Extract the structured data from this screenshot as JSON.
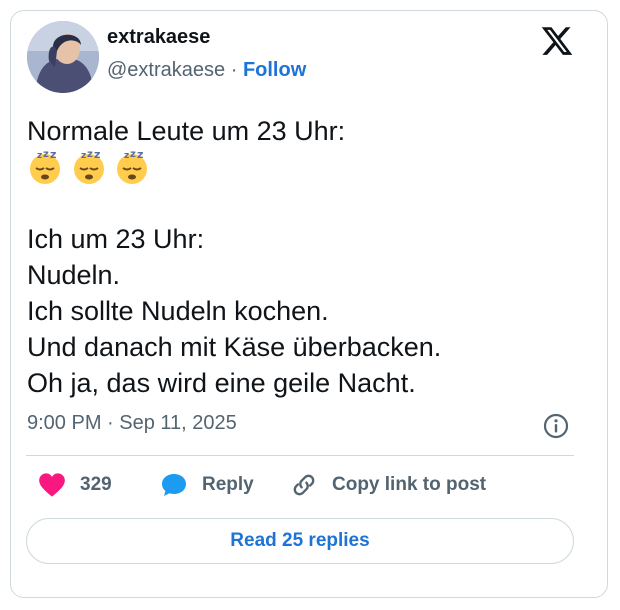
{
  "tweet": {
    "author_name": "extrakaese",
    "handle": "@extrakaese",
    "separator": "·",
    "follow_label": "Follow",
    "lines": [
      "Normale Leute um 23 Uhr:",
      "Ich um 23 Uhr:",
      "Nudeln.",
      "Ich sollte Nudeln kochen.",
      "Und danach mit Käse überbacken.",
      "Oh ja, das wird eine geile Nacht."
    ],
    "emojis": [
      "sleeping-face-emoji",
      "sleeping-face-emoji",
      "sleeping-face-emoji"
    ],
    "timestamp": "9:00 PM · Sep 11, 2025"
  },
  "actions": {
    "like_count": "329",
    "reply_label": "Reply",
    "copy_label": "Copy link to post"
  },
  "footer": {
    "read_replies_label": "Read 25 replies"
  },
  "colors": {
    "accent": "#1d74d6",
    "like": "#f91880",
    "muted_text": "#536471",
    "border": "#cfd9de"
  },
  "icons": {
    "brand": "x-logo-icon",
    "info": "info-icon",
    "like": "heart-icon",
    "reply": "speech-bubble-icon",
    "copy": "link-icon"
  }
}
